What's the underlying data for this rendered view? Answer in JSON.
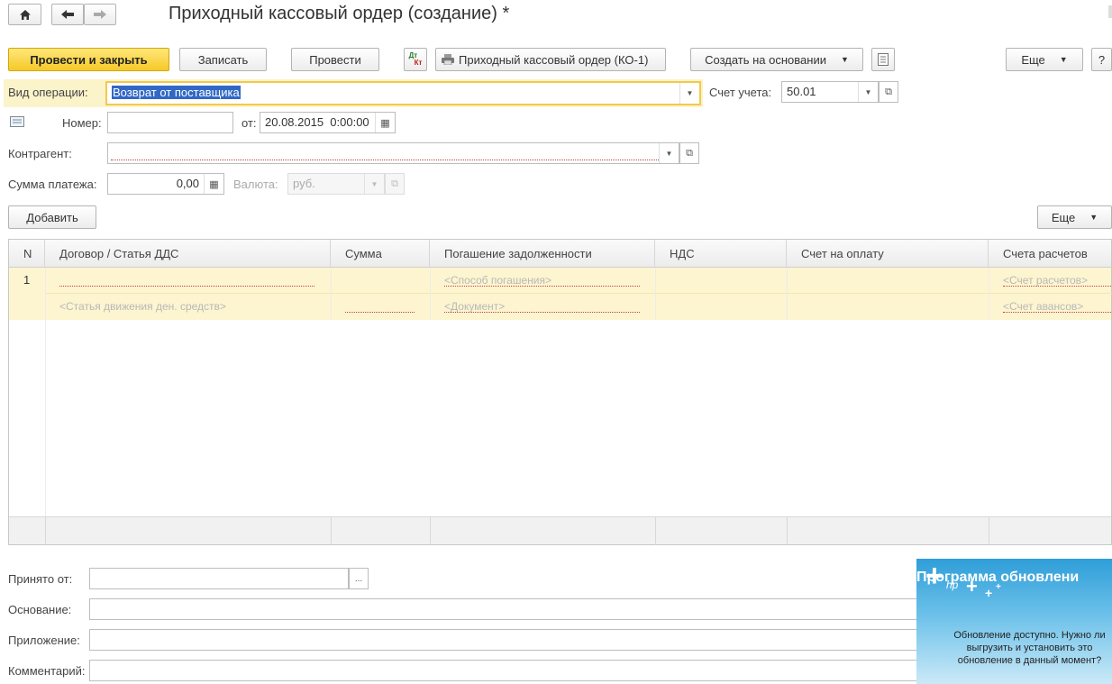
{
  "window": {
    "title": "Приходный кассовый ордер (создание) *",
    "home_icon": "home-icon",
    "back_icon": "arrow-left-icon",
    "forward_icon": "arrow-right-icon"
  },
  "toolbar": {
    "post_close": "Провести и закрыть",
    "save": "Записать",
    "post": "Провести",
    "dtkt_icon": "dt-kt-icon",
    "dtkt_top": "Дт",
    "dtkt_bottom": "Кт",
    "print_label": "Приходный кассовый ордер (КО-1)",
    "create_based": "Создать на основании",
    "more": "Еще",
    "help": "?"
  },
  "form": {
    "operation_label": "Вид операции:",
    "operation_value": "Возврат от поставщика",
    "account_label": "Счет учета:",
    "account_value": "50.01",
    "number_label": "Номер:",
    "number_value": "",
    "date_label": "от:",
    "date_value": "20.08.2015  0:00:00",
    "counterparty_label": "Контрагент:",
    "counterparty_value": "",
    "amount_label": "Сумма платежа:",
    "amount_value": "0,00",
    "currency_label": "Валюта:",
    "currency_value": "руб."
  },
  "table_toolbar": {
    "add": "Добавить",
    "more": "Еще"
  },
  "table": {
    "columns": [
      "N",
      "Договор / Статья ДДС",
      "Сумма",
      "Погашение задолженности",
      "НДС",
      "Счет на оплату",
      "Счета расчетов"
    ],
    "rows": [
      {
        "n": "1",
        "contract": "",
        "cash_flow_item": "<Статья движения ден. средств>",
        "amount": "",
        "repayment_method": "<Способ погашения>",
        "document": "<Документ>",
        "vat": "",
        "invoice": "",
        "settlement_account": "<Счет расчетов>",
        "advance_account": "<Счет авансов>"
      }
    ]
  },
  "bottom": {
    "received_from_label": "Принято от:",
    "received_from_value": "",
    "received_from_btn": "...",
    "basis_label": "Основание:",
    "attachment_label": "Приложение:",
    "comment_label": "Комментарий:"
  },
  "popup": {
    "title": "Программа обновлени",
    "logo": "hp",
    "message": "Обновление доступно. Нужно ли выгрузить и установить это обновление в данный момент?"
  },
  "colors": {
    "primary_button": "#f5c928",
    "selected_row": "#fdf5cf",
    "popup_blue": "#2f9ed8"
  }
}
